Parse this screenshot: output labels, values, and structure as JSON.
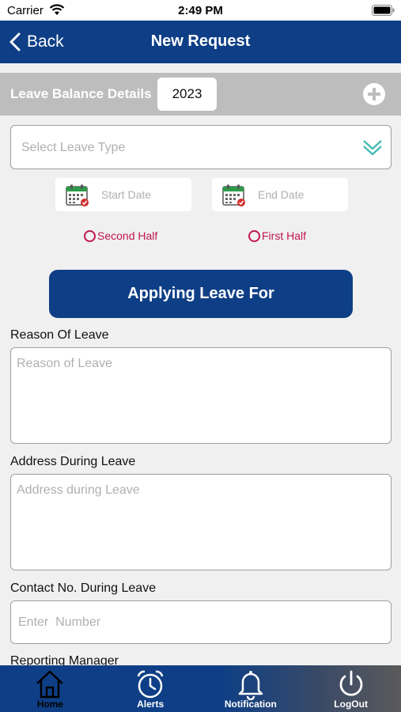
{
  "status": {
    "carrier": "Carrier",
    "time": "2:49 PM"
  },
  "nav": {
    "back_label": "Back",
    "title": "New Request"
  },
  "balance": {
    "label": "Leave Balance Details",
    "year": "2023"
  },
  "form": {
    "leave_type_placeholder": "Select Leave Type",
    "start_date_placeholder": "Start Date",
    "end_date_placeholder": "End Date",
    "radio_second_half": "Second Half",
    "radio_first_half": "First Half",
    "apply_button": "Applying Leave For",
    "reason_label": "Reason Of Leave",
    "reason_placeholder": "Reason of Leave",
    "address_label": "Address During Leave",
    "address_placeholder": "Address during Leave",
    "contact_label": "Contact No. During Leave",
    "contact_placeholder": "Enter  Number",
    "manager_label": "Reporting Manager"
  },
  "tabs": [
    {
      "label": "Home",
      "icon": "home-icon"
    },
    {
      "label": "Alerts",
      "icon": "alarm-clock-icon"
    },
    {
      "label": "Notification",
      "icon": "bell-icon"
    },
    {
      "label": "LogOut",
      "icon": "power-icon"
    }
  ],
  "colors": {
    "primary": "#0e3f86",
    "radio_accent": "#c0164e",
    "chevron_accent": "#3fb8b0",
    "balance_bar": "#bdbdbd"
  }
}
